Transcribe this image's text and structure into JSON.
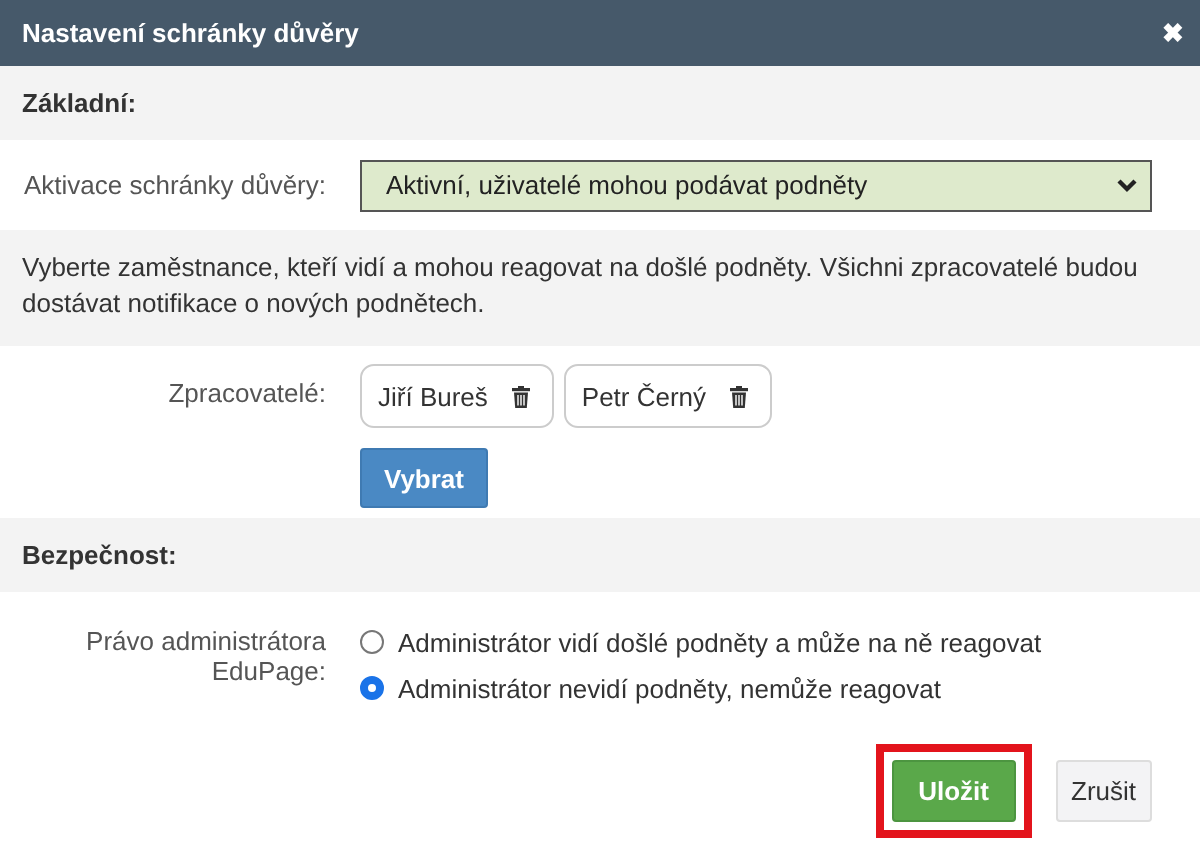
{
  "window": {
    "title": "Nastavení schránky důvěry",
    "close": "✖"
  },
  "sections": [
    {
      "kind": "header",
      "text": "Základní:"
    },
    {
      "kind": "select",
      "label": "Aktivace schránky důvěry:",
      "value": "Aktivní, uživatelé mohou podávat podněty"
    },
    {
      "kind": "note",
      "text": "Vyberte zaměstnance, kteří vidí a mohou reagovat na došlé podněty. Všichni zpracovatelé budou dostávat notifikace o nových podnětech."
    },
    {
      "kind": "people",
      "label": "Zpracovatelé:",
      "people": [
        "Jiří Bureš",
        "Petr Černý"
      ],
      "button": "Vybrat"
    },
    {
      "kind": "header",
      "text": "Bezpečnost:"
    },
    {
      "kind": "radios",
      "label": "Právo administrátora EduPage:",
      "options": [
        {
          "label": "Administrátor vidí došlé podněty a může na ně reagovat",
          "selected": false
        },
        {
          "label": "Administrátor nevidí podněty, nemůže reagovat",
          "selected": true
        }
      ]
    }
  ],
  "buttons": [
    {
      "label": "Uložit",
      "kind": "primary",
      "highlighted": true
    },
    {
      "label": "Zrušit",
      "kind": "default",
      "highlighted": false
    }
  ]
}
